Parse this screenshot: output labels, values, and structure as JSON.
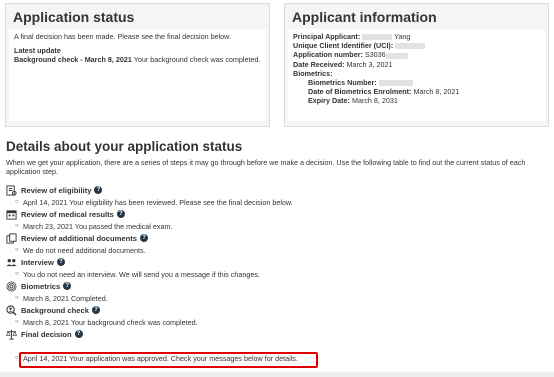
{
  "status_panel": {
    "title": "Application status",
    "message": "A final decision has been made. Please see the final decision below.",
    "latest_update_label": "Latest update",
    "update_title": "Background check - March 8, 2021",
    "update_text": " Your background check was completed."
  },
  "applicant_panel": {
    "title": "Applicant information",
    "principal_label": "Principal Applicant:",
    "principal_name": "Yang",
    "uci_label": "Unique Client Identifier (UCI):",
    "app_number_label": "Application number:",
    "app_number_value": "S3036",
    "date_received_label": "Date Received:",
    "date_received_value": "March 3, 2021",
    "biometrics_label": "Biometrics:",
    "biometrics_number_label": "Biometrics Number:",
    "enrolment_label": "Date of Biometrics Enrolment:",
    "enrolment_value": "March 8, 2021",
    "expiry_label": "Expiry Date:",
    "expiry_value": "March 8, 2031"
  },
  "details": {
    "title": "Details about your application status",
    "intro": "When we get your application, there are a series of steps it may go through before we make a decision. Use the following table to find out the current status of each application step."
  },
  "steps": [
    {
      "title": "Review of eligibility",
      "icon": "eligibility-icon",
      "detail": "April 14, 2021 Your eligibility has been reviewed. Please see the final decision below."
    },
    {
      "title": "Review of medical results",
      "icon": "calendar-icon",
      "detail": "March 23, 2021 You passed the medical exam."
    },
    {
      "title": "Review of additional documents",
      "icon": "documents-icon",
      "detail": "We do not need additional documents."
    },
    {
      "title": "Interview",
      "icon": "people-icon",
      "detail": "You do not need an interview. We will send you a message if this changes."
    },
    {
      "title": "Biometrics",
      "icon": "fingerprint-icon",
      "detail": "March 8, 2021 Completed."
    },
    {
      "title": "Background check",
      "icon": "search-person-icon",
      "detail": "March 8, 2021 Your background check was completed."
    },
    {
      "title": "Final decision",
      "icon": "scales-icon",
      "detail": "April 14, 2021 Your application was approved. Check your messages below for details."
    }
  ],
  "help_glyph": "?",
  "colors": {
    "highlight": "#e00000",
    "help_badge": "#26374a",
    "panel_bg": "#f5f5f5"
  }
}
